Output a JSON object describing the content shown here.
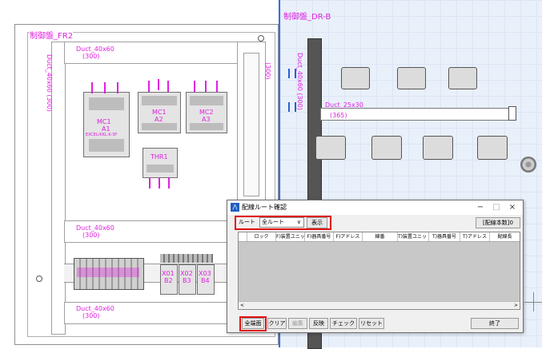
{
  "cad": {
    "panel_left_title": "制御盤_FR2",
    "panel_right_title": "制御盤_DR-B",
    "duct_top": "Duct_40x60",
    "duct_top_len": "(300)",
    "duct_vert_left": "Duct_40x60",
    "duct_vert_left_len": "(300)",
    "duct_mid": "Duct_40x60",
    "duct_mid_len": "(300)",
    "duct_bottom": "Duct_40x60",
    "duct_bottom_len": "(300)",
    "duct_right_vert": "Duct_40x60",
    "duct_right_vert_len": "(300)",
    "duct_right_horiz": "Duct_25x30",
    "duct_right_horiz_len": "(365)",
    "right_side_label": "(300)",
    "comp_mc1": "MC1",
    "comp_mc1_sub": "A1",
    "comp_mc1_desc": "EXCEL/KKL-K-3P",
    "comp_mc1b": "MC1",
    "comp_mc1b_sub": "A2",
    "comp_mc2": "MC2",
    "comp_mc2_sub": "A3",
    "comp_thr": "THR1",
    "comp_x01": "X01",
    "comp_x01_sub": "B2",
    "comp_x02": "X02",
    "comp_x02_sub": "B3",
    "comp_x03": "X03",
    "comp_x03_sub": "B4"
  },
  "dialog": {
    "title": "配線ルート確認",
    "route_label": "ルート",
    "route_select": "全ルート",
    "show_button": "表示",
    "wire_count_button": "[配線本数]0",
    "columns": [
      "ロック",
      "F)装置ユニット",
      "F)器具番号",
      "F)アドレス",
      "線番",
      "T)装置ユニット",
      "T)器具番号",
      "T)アドレス",
      "配線長"
    ],
    "buttons": {
      "show_all": "全端面",
      "clear": "クリア",
      "edit": "編集",
      "reflect": "反映",
      "check": "チェック",
      "reset": "リセット",
      "close": "終了"
    },
    "window_minimize": "−",
    "window_maximize": "□",
    "window_close": "×"
  },
  "colors": {
    "cad_label": "#e020e0",
    "highlight": "#e01010",
    "blue_frame": "#3a6fd8"
  }
}
